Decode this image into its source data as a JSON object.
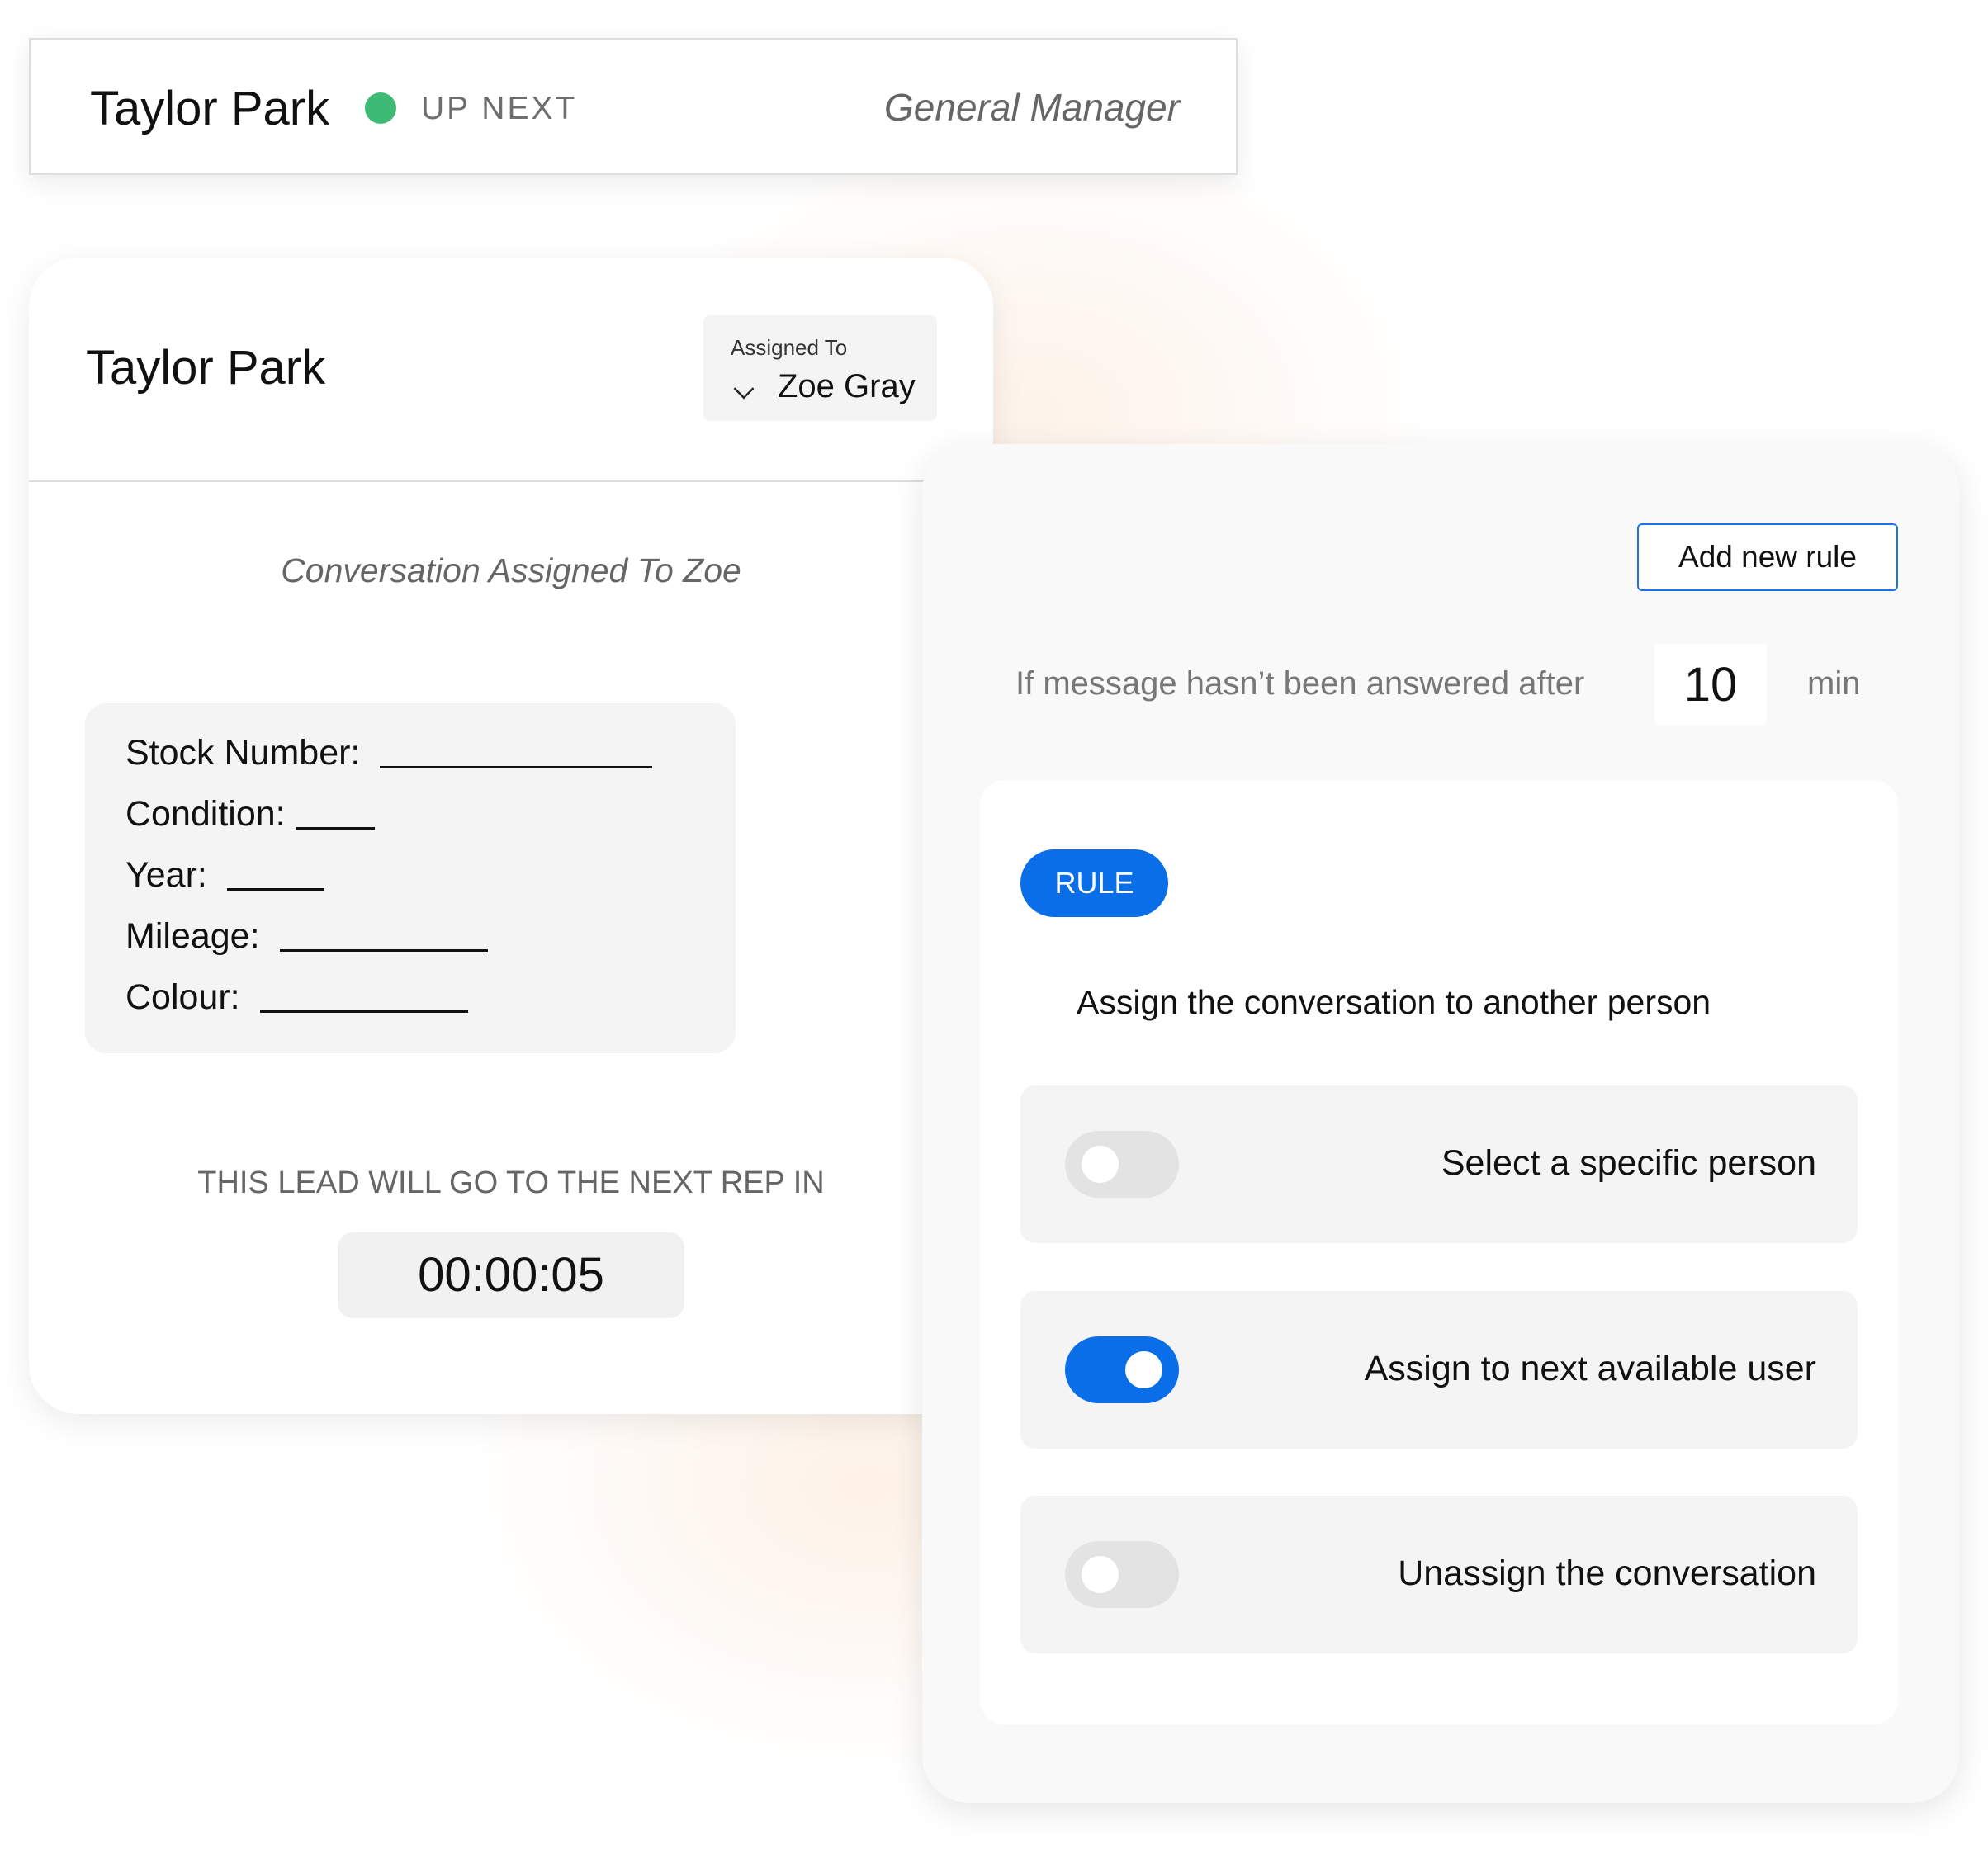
{
  "top_card": {
    "name": "Taylor Park",
    "status": "UP NEXT",
    "status_color": "#3dba74",
    "role": "General Manager"
  },
  "lead_card": {
    "name": "Taylor Park",
    "assigned_label": "Assigned To",
    "assigned_value": "Zoe Gray",
    "conversation_note": "Conversation Assigned To Zoe",
    "details": [
      {
        "label": "Stock Number:",
        "value": ""
      },
      {
        "label": "Condition:",
        "value": ""
      },
      {
        "label": "Year:",
        "value": ""
      },
      {
        "label": "Mileage:",
        "value": ""
      },
      {
        "label": "Colour:",
        "value": ""
      }
    ],
    "countdown_label": "THIS LEAD WILL GO TO THE NEXT REP IN",
    "countdown": "00:00:05"
  },
  "rules_panel": {
    "add_rule_label": "Add new rule",
    "condition_prefix": "If message hasn’t been answered after",
    "minutes": "10",
    "minutes_unit": "min",
    "rule_badge": "RULE",
    "rule_heading": "Assign the conversation to another person",
    "accent_color": "#0a6ee8",
    "options": [
      {
        "label": "Select a specific person",
        "enabled": false
      },
      {
        "label": "Assign to next available user",
        "enabled": true
      },
      {
        "label": "Unassign the conversation",
        "enabled": false
      }
    ]
  }
}
